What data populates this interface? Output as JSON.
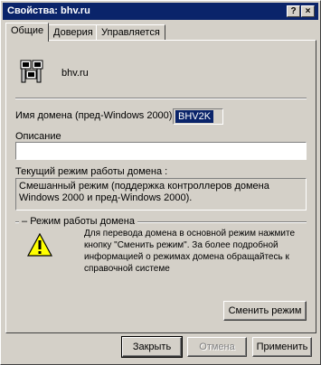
{
  "window": {
    "title": "Свойства: bhv.ru",
    "buttons": {
      "help": "?",
      "close": "×"
    }
  },
  "tabs": [
    {
      "label": "Общие",
      "active": true
    },
    {
      "label": "Доверия",
      "active": false
    },
    {
      "label": "Управляется",
      "active": false
    }
  ],
  "general": {
    "domain_name": "bhv.ru",
    "icon": "domain-computers-icon",
    "netbios_label": "Имя домена (пред-Windows 2000):",
    "netbios_value": "BHV2K",
    "description_label": "Описание",
    "description_value": "",
    "mode_label": "Текущий режим работы домена :",
    "mode_value": "Смешанный режим (поддержка контроллеров домена Windows 2000 и пред-Windows 2000).",
    "mode_group_label": "Режим работы домена",
    "warning_icon": "warning-icon",
    "info_text": "Для перевода домена в основной режим нажмите кнопку \"Сменить режим\". За более подробной информацией о режимах домена обращайтесь к справочной системе",
    "change_mode_button": "Сменить режим"
  },
  "footer": {
    "close_button": "Закрыть",
    "cancel_button": "Отмена",
    "apply_button": "Применить"
  },
  "colors": {
    "titlebar": "#0a246a",
    "face": "#d4d0c8",
    "selection": "#0a246a",
    "warning": "#ffff00"
  }
}
